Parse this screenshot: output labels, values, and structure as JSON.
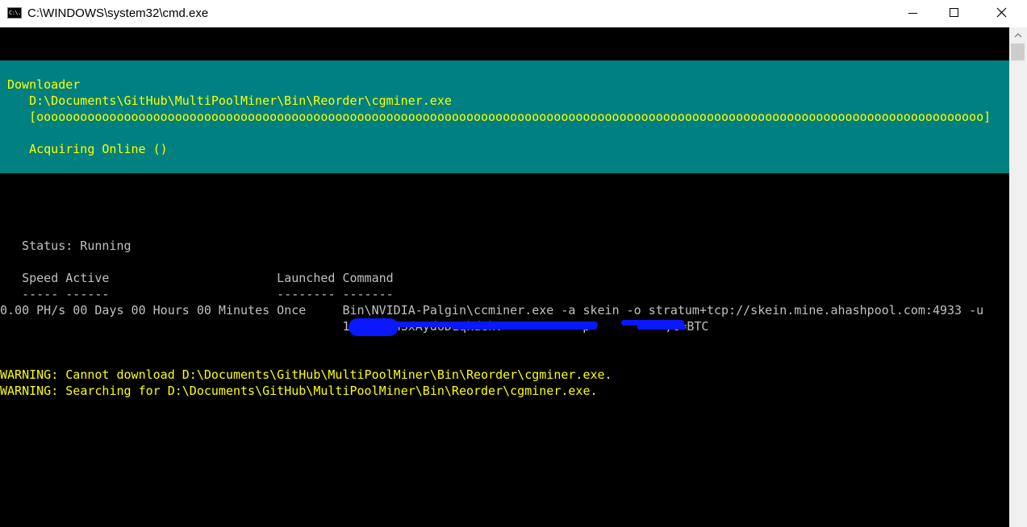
{
  "window": {
    "title": "C:\\WINDOWS\\system32\\cmd.exe",
    "icon_label": "C:\\.",
    "icon": "cmd-icon"
  },
  "controls": {
    "minimize_icon": "minimize-icon",
    "maximize_icon": "maximize-icon",
    "close_icon": "close-icon"
  },
  "console": {
    "downloader": {
      "heading": "Downloader",
      "path": "   D:\\Documents\\GitHub\\MultiPoolMiner\\Bin\\Reorder\\cgminer.exe",
      "progress": "   [oooooooooooooooooooooooooooooooooooooooooooooooooooooooooooooooooooooooooooooooooooooooooooooooooooooooooooooooooooooooooooooooooo]",
      "status": "   Acquiring Online ()"
    },
    "status_line": "  Status: Running",
    "table": {
      "header": "   Speed Active                       Launched Command",
      "underline": "   ----- ------                       -------- -------",
      "row1": "0.00 PH/s 00 Days 00 Hours 00 Minutes Once     Bin\\NVIDIA-Palgin\\ccminer.exe -a skein -o stratum+tcp://skein.mine.ahashpool.com:4933 -u",
      "row2_prefix": "                                               1",
      "row2_visible_a": "oHBmnyhSxAyd6D1qkdGh:",
      "row2_visible_b": " -p ",
      "row2_suffix": ",c=BTC"
    },
    "warnings": [
      "WARNING: Cannot download D:\\Documents\\GitHub\\MultiPoolMiner\\Bin\\Reorder\\cgminer.exe.",
      "WARNING: Searching for D:\\Documents\\GitHub\\MultiPoolMiner\\Bin\\Reorder\\cgminer.exe."
    ]
  },
  "colors": {
    "console_bg": "#000000",
    "panel_bg": "#008080",
    "highlight_text": "#ffff00",
    "normal_text": "#c0c0c0",
    "redaction": "#0a18ff"
  }
}
